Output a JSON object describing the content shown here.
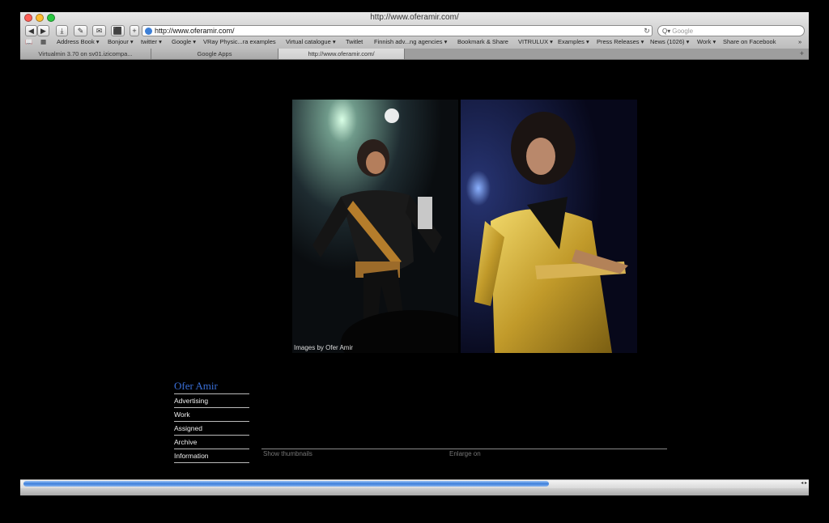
{
  "window": {
    "title": "http://www.oferamir.com/",
    "traffic_lights": [
      "#ff5f57",
      "#febc2e",
      "#28c840"
    ]
  },
  "toolbar": {
    "back_icon": "◀",
    "forward_icon": "▶",
    "download_icon": "⤓",
    "edit_icon": "✎",
    "share_icon": "✉",
    "ext_icon": "⬛",
    "add_icon": "+",
    "url": "http://www.oferamir.com/",
    "reload_icon": "↻",
    "search_placeholder": "Google",
    "search_icon": "Q▾"
  },
  "bookmarks": {
    "items": [
      "Address Book ▾",
      "Bonjour ▾",
      "twitter ▾",
      "Google ▾",
      "VRay Physic...ra examples",
      "Virtual catalogue ▾",
      "Twitlet",
      "Finnish adv...ng agencies ▾",
      "Bookmark & Share",
      "VITRULUX ▾",
      "Examples ▾",
      "Press Releases ▾",
      "News (1026) ▾",
      "Work ▾",
      "Share on Facebook"
    ],
    "more": "»"
  },
  "tabs": {
    "items": [
      "Virtualmin 3.70 on sv01.izicompa...",
      "Google Apps",
      "http://www.oferamir.com/"
    ],
    "add_label": "+"
  },
  "gallery": {
    "caption": "Images by Ofer Amir"
  },
  "nav": {
    "title": "Ofer Amir",
    "items": [
      "Advertising",
      "Work",
      "Assigned",
      "Archive",
      "Information"
    ]
  },
  "controls": {
    "thumbnails": "Show thumbnails",
    "enlarge": "Enlarge on"
  },
  "scrollbar": {
    "arrows": "◂ ▸",
    "position": 0.67
  }
}
